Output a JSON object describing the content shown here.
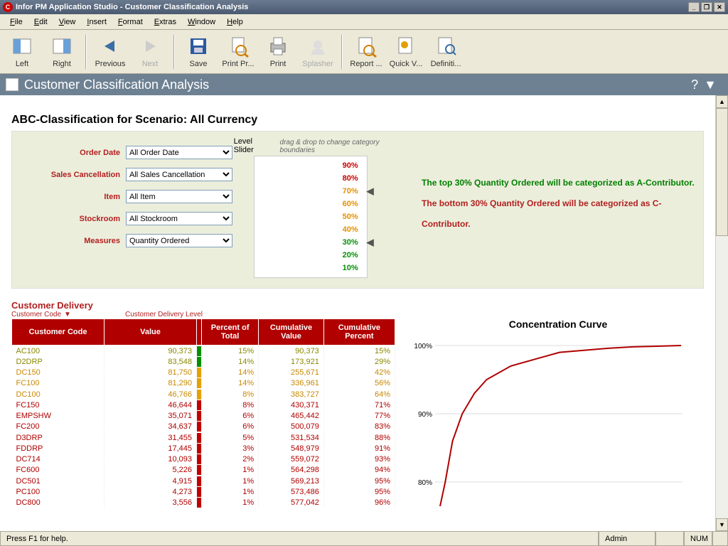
{
  "app": {
    "title": "Infor PM Application Studio - Customer Classification Analysis"
  },
  "menus": [
    "File",
    "Edit",
    "View",
    "Insert",
    "Format",
    "Extras",
    "Window",
    "Help"
  ],
  "toolbar": [
    {
      "label": "Left",
      "icon": "left-pane"
    },
    {
      "label": "Right",
      "icon": "right-pane"
    },
    {
      "label": "Previous",
      "icon": "arrow-left"
    },
    {
      "label": "Next",
      "icon": "arrow-right",
      "disabled": true
    },
    {
      "label": "Save",
      "icon": "floppy"
    },
    {
      "label": "Print Pr...",
      "icon": "print-preview"
    },
    {
      "label": "Print",
      "icon": "printer"
    },
    {
      "label": "Splasher",
      "icon": "splasher",
      "disabled": true
    },
    {
      "label": "Report ...",
      "icon": "report"
    },
    {
      "label": "Quick V...",
      "icon": "quick-view"
    },
    {
      "label": "Definiti...",
      "icon": "definition"
    }
  ],
  "header": {
    "title": "Customer Classification Analysis"
  },
  "section_title": "ABC-Classification for Scenario: All Currency",
  "filters": {
    "rows": [
      {
        "label": "Order Date",
        "value": "All Order Date"
      },
      {
        "label": "Sales Cancellation",
        "value": "All Sales Cancellation"
      },
      {
        "label": "Item",
        "value": "All Item"
      },
      {
        "label": "Stockroom",
        "value": "All Stockroom"
      },
      {
        "label": "Measures",
        "value": "Quantity Ordered"
      }
    ]
  },
  "slider": {
    "label": "Level Slider",
    "hint": "drag & drop to change category boundaries",
    "ticks": [
      {
        "pct": "90%",
        "cls": "red"
      },
      {
        "pct": "80%",
        "cls": "red"
      },
      {
        "pct": "70%",
        "cls": "orange",
        "marker": true
      },
      {
        "pct": "60%",
        "cls": "orange"
      },
      {
        "pct": "50%",
        "cls": "orange"
      },
      {
        "pct": "40%",
        "cls": "orange"
      },
      {
        "pct": "30%",
        "cls": "green",
        "marker": true
      },
      {
        "pct": "20%",
        "cls": "green"
      },
      {
        "pct": "10%",
        "cls": "green"
      }
    ]
  },
  "info": {
    "top": "The top 30% Quantity Ordered will be categorized as A-Contributor.",
    "bottom": "The bottom 30% Quantity Ordered will be categorized as C-Contributor."
  },
  "delivery": {
    "title": "Customer Delivery",
    "sub1": "Customer Code",
    "sub2": "Customer Delivery Level",
    "columns": [
      "Customer Code",
      "Value",
      "Percent of Total",
      "Cumulative Value",
      "Cumulative Percent"
    ],
    "rows": [
      {
        "code": "AC100",
        "value": "90,373",
        "pct": "15%",
        "cval": "90,373",
        "cpct": "15%",
        "cls": "green"
      },
      {
        "code": "D2DRP",
        "value": "83,548",
        "pct": "14%",
        "cval": "173,921",
        "cpct": "29%",
        "cls": "green"
      },
      {
        "code": "DC150",
        "value": "81,750",
        "pct": "14%",
        "cval": "255,671",
        "cpct": "42%",
        "cls": "orange"
      },
      {
        "code": "FC100",
        "value": "81,290",
        "pct": "14%",
        "cval": "336,961",
        "cpct": "56%",
        "cls": "orange"
      },
      {
        "code": "DC100",
        "value": "46,766",
        "pct": "8%",
        "cval": "383,727",
        "cpct": "64%",
        "cls": "orange"
      },
      {
        "code": "FC150",
        "value": "46,644",
        "pct": "8%",
        "cval": "430,371",
        "cpct": "71%",
        "cls": "red"
      },
      {
        "code": "EMPSHW",
        "value": "35,071",
        "pct": "6%",
        "cval": "465,442",
        "cpct": "77%",
        "cls": "red"
      },
      {
        "code": "FC200",
        "value": "34,637",
        "pct": "6%",
        "cval": "500,079",
        "cpct": "83%",
        "cls": "red"
      },
      {
        "code": "D3DRP",
        "value": "31,455",
        "pct": "5%",
        "cval": "531,534",
        "cpct": "88%",
        "cls": "red"
      },
      {
        "code": "FDDRP",
        "value": "17,445",
        "pct": "3%",
        "cval": "548,979",
        "cpct": "91%",
        "cls": "red"
      },
      {
        "code": "DC714",
        "value": "10,093",
        "pct": "2%",
        "cval": "559,072",
        "cpct": "93%",
        "cls": "red"
      },
      {
        "code": "FC600",
        "value": "5,226",
        "pct": "1%",
        "cval": "564,298",
        "cpct": "94%",
        "cls": "red"
      },
      {
        "code": "DC501",
        "value": "4,915",
        "pct": "1%",
        "cval": "569,213",
        "cpct": "95%",
        "cls": "red"
      },
      {
        "code": "PC100",
        "value": "4,273",
        "pct": "1%",
        "cval": "573,486",
        "cpct": "95%",
        "cls": "red"
      },
      {
        "code": "DC800",
        "value": "3,556",
        "pct": "1%",
        "cval": "577,042",
        "cpct": "96%",
        "cls": "red"
      }
    ]
  },
  "chart_data": {
    "type": "line",
    "title": "Concentration Curve",
    "xlabel": "",
    "ylabel": "",
    "ylim": [
      75,
      101
    ],
    "yticks": [
      "100%",
      "90%",
      "80%"
    ],
    "x": [
      0,
      0.03,
      0.06,
      0.1,
      0.15,
      0.2,
      0.3,
      0.4,
      0.5,
      0.6,
      0.7,
      0.8,
      0.9,
      1.0
    ],
    "values": [
      75,
      80,
      86,
      90,
      93,
      95,
      97,
      98,
      99,
      99.3,
      99.6,
      99.8,
      99.9,
      100
    ]
  },
  "status": {
    "help": "Press F1 for help.",
    "user": "Admin",
    "num": "NUM"
  }
}
